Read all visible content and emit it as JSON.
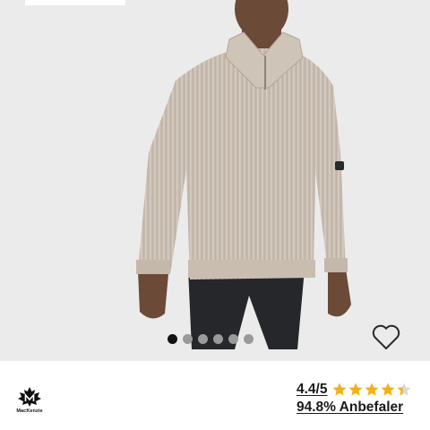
{
  "product": {
    "image_alt": "Man wearing a beige ribbed half-zip wool sweater with dark trousers"
  },
  "gallery": {
    "dot_count": 6,
    "active_index": 0
  },
  "brand": {
    "name": "MacKenzie"
  },
  "rating": {
    "score_text": "4.4/5",
    "value": 4.4,
    "max": 5,
    "star_color": "#f2b01e",
    "recommend_text": "94.8% Anbefaler"
  },
  "icons": {
    "wishlist": "heart-outline-icon",
    "logo": "maple-leaf-m-icon",
    "star": "star-icon"
  }
}
